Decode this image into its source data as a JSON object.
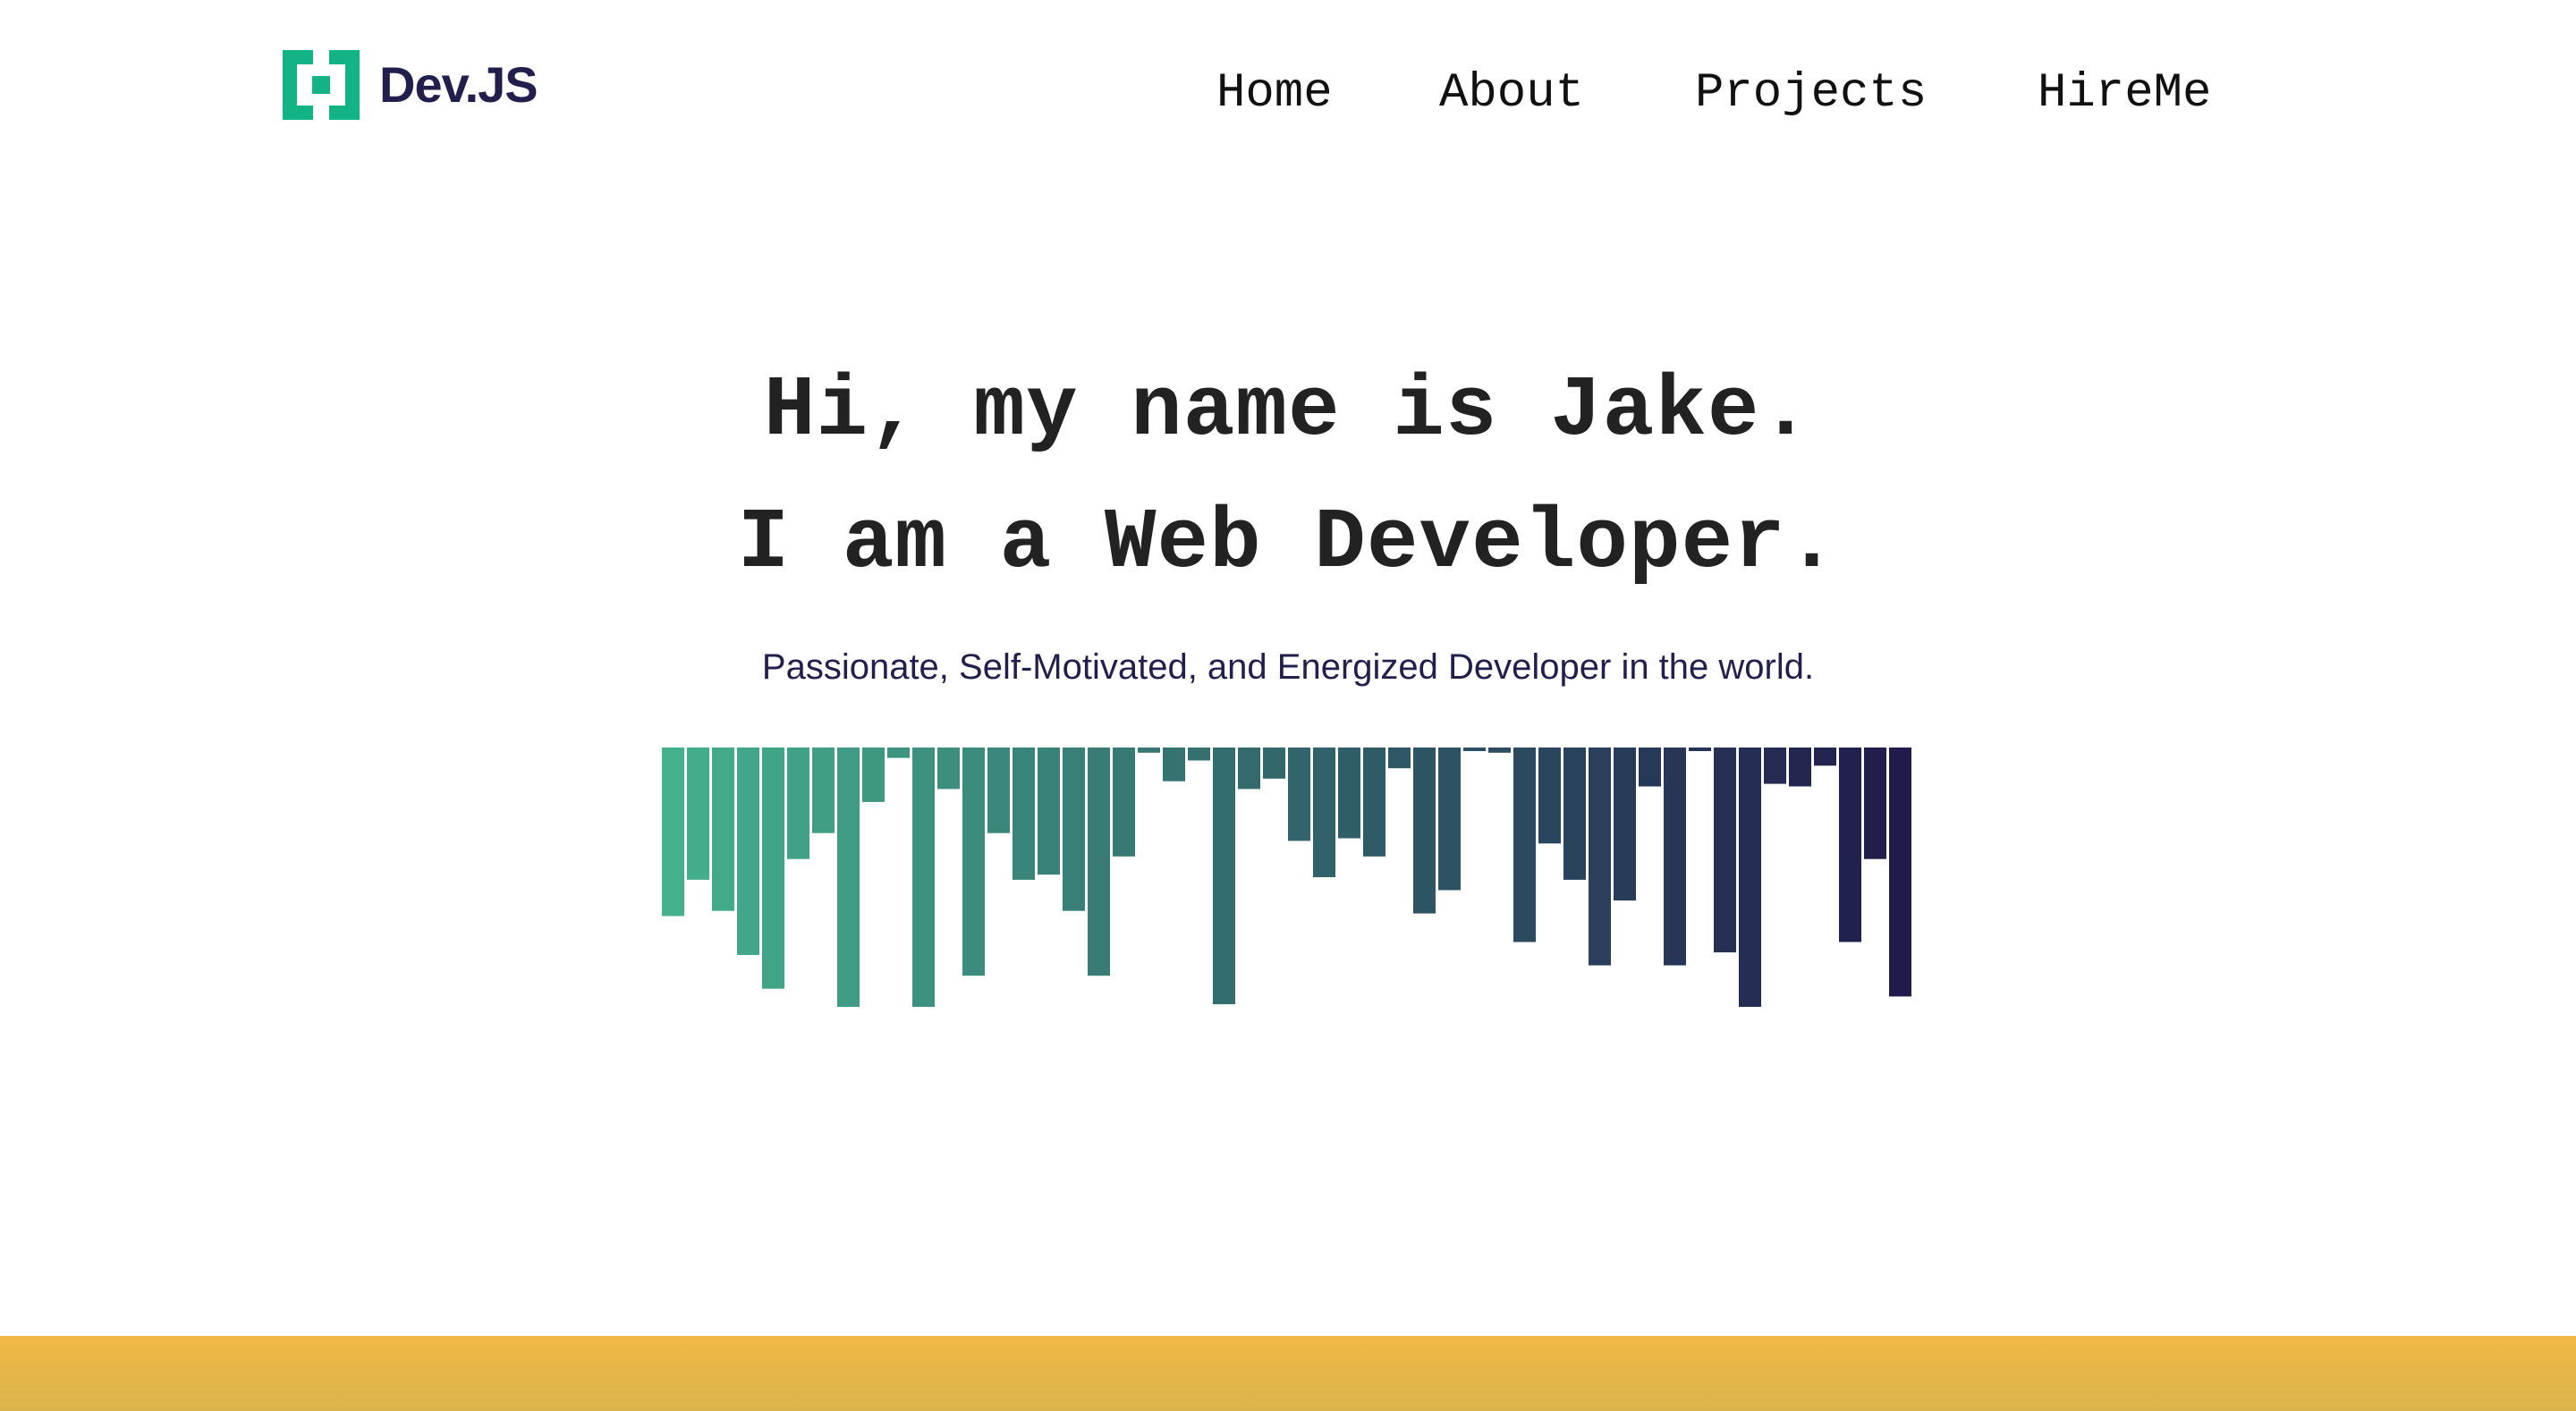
{
  "brand": {
    "name": "Dev.JS",
    "logo_icon": "bracket-square-icon",
    "primary_color": "#14b386",
    "text_color": "#221f4d"
  },
  "nav": {
    "items": [
      {
        "label": "Home"
      },
      {
        "label": "About"
      },
      {
        "label": "Projects"
      },
      {
        "label": "HireMe"
      }
    ]
  },
  "hero": {
    "line1": "Hi, my name is Jake.",
    "line2": "I am a Web Developer.",
    "subtitle": "Passionate, Self-Motivated, and Energized Developer in the world."
  },
  "decoration": {
    "bars": [
      0.65,
      0.51,
      0.63,
      0.8,
      0.93,
      0.43,
      0.33,
      1.0,
      0.21,
      0.04,
      1.0,
      0.16,
      0.88,
      0.33,
      0.51,
      0.49,
      0.63,
      0.88,
      0.42,
      0.02,
      0.13,
      0.05,
      0.99,
      0.16,
      0.12,
      0.36,
      0.5,
      0.35,
      0.42,
      0.08,
      0.64,
      0.55,
      0.01,
      0.02,
      0.75,
      0.37,
      0.51,
      0.84,
      0.59,
      0.15,
      0.84,
      0.01,
      0.79,
      1.0,
      0.14,
      0.15,
      0.07,
      0.75,
      0.43,
      0.96
    ],
    "gradient_start": "#44b08c",
    "gradient_end": "#201b4b"
  },
  "footer_band": {
    "color_top": "#f2b846",
    "color_bottom": "#d9b44a"
  }
}
